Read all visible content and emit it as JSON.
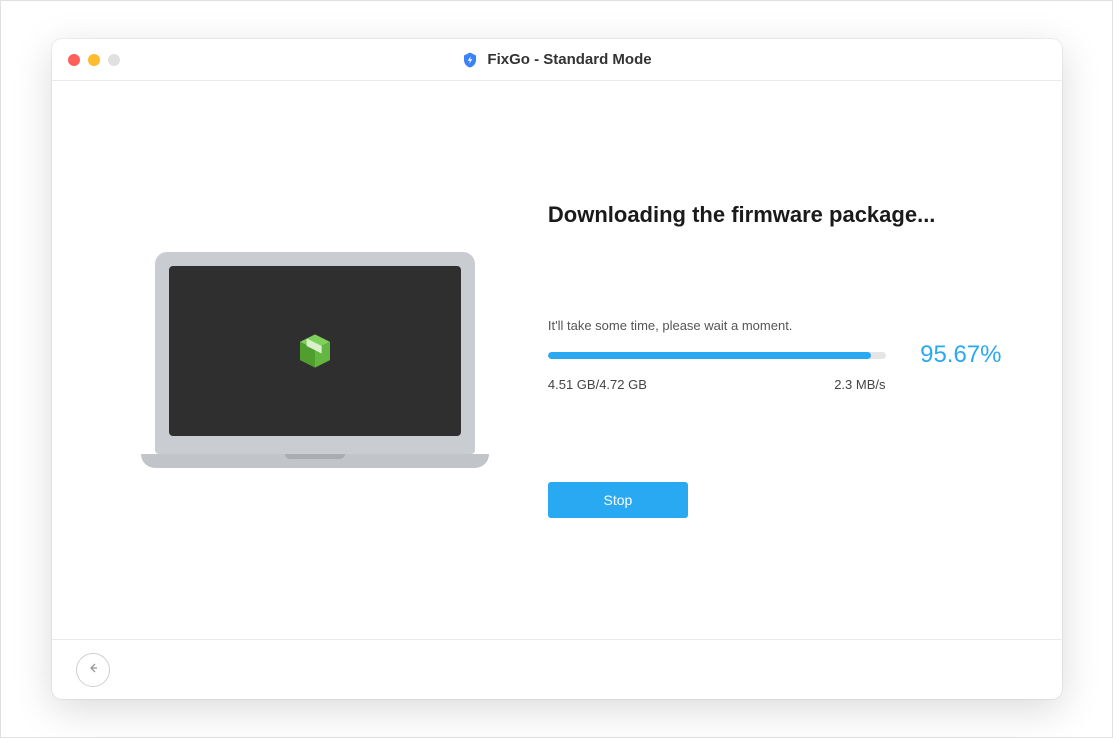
{
  "window": {
    "title": "FixGo - Standard Mode"
  },
  "main": {
    "heading": "Downloading the firmware package...",
    "subtext": "It'll take some time, please wait a moment.",
    "progress_percent": 95.67,
    "percent_label": "95.67%",
    "downloaded_label": "4.51 GB/4.72 GB",
    "speed_label": "2.3 MB/s",
    "stop_label": "Stop"
  },
  "icons": {
    "app": "fixgo-shield-icon",
    "package": "package-box-icon",
    "back": "arrow-left-icon"
  },
  "colors": {
    "accent": "#2aa9f3",
    "package": "#5fb63c"
  }
}
